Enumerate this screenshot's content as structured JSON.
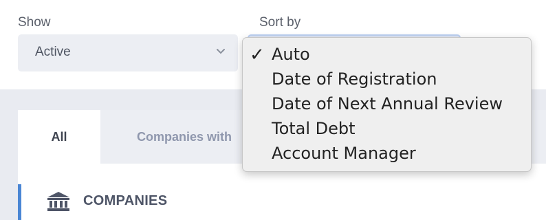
{
  "filters": {
    "show_label": "Show",
    "show_value": "Active",
    "sort_label": "Sort by"
  },
  "tabs": [
    {
      "label": "All",
      "active": true
    },
    {
      "label": "Companies with",
      "active": false
    }
  ],
  "section": {
    "title": "COMPANIES",
    "icon": "bank-icon"
  },
  "sort_menu": {
    "selected_mark": "✓",
    "items": [
      {
        "label": "Auto",
        "selected": true
      },
      {
        "label": "Date of Registration",
        "selected": false
      },
      {
        "label": "Date of Next Annual Review",
        "selected": false
      },
      {
        "label": "Total Debt",
        "selected": false
      },
      {
        "label": "Account Manager",
        "selected": false
      }
    ]
  },
  "colors": {
    "accent": "#4a86d4",
    "background": "#e9ebf1",
    "menu_background": "#efefef"
  }
}
